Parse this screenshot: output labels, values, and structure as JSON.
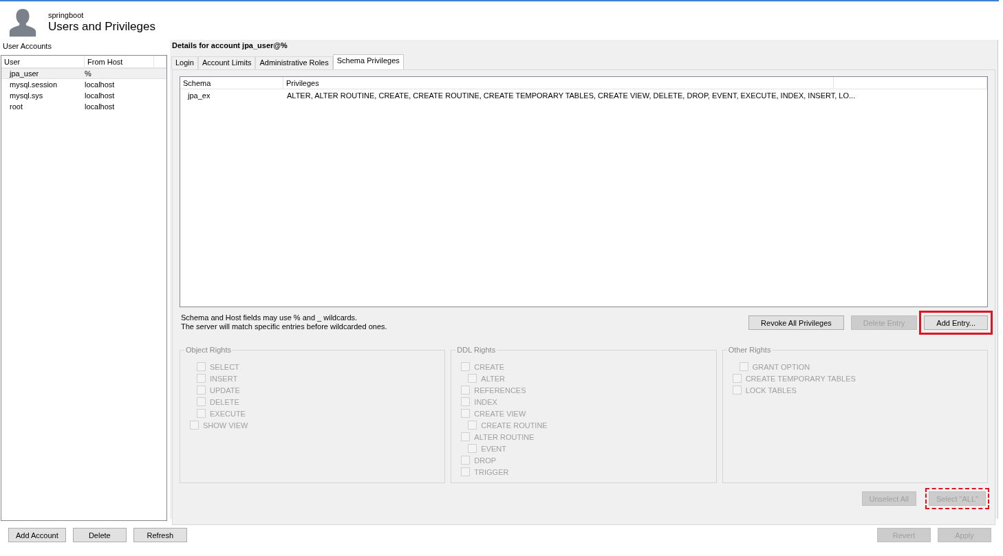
{
  "header": {
    "connection": "springboot",
    "title": "Users and Privileges"
  },
  "user_accounts": {
    "label": "User Accounts",
    "columns": [
      "User",
      "From Host"
    ],
    "rows": [
      {
        "user": "jpa_user",
        "host": "%",
        "selected": true
      },
      {
        "user": "mysql.session",
        "host": "localhost",
        "selected": false
      },
      {
        "user": "mysql.sys",
        "host": "localhost",
        "selected": false
      },
      {
        "user": "root",
        "host": "localhost",
        "selected": false
      }
    ],
    "buttons": [
      {
        "label": "Add Account",
        "disabled": false
      },
      {
        "label": "Delete",
        "disabled": false
      },
      {
        "label": "Refresh",
        "disabled": false
      }
    ]
  },
  "details": {
    "title": "Details for account jpa_user@%",
    "tabs": [
      {
        "label": "Login",
        "selected": false
      },
      {
        "label": "Account Limits",
        "selected": false
      },
      {
        "label": "Administrative Roles",
        "selected": false
      },
      {
        "label": "Schema Privileges",
        "selected": true
      }
    ],
    "privileges_table": {
      "columns": [
        "Schema",
        "Privileges"
      ],
      "rows": [
        {
          "schema": "jpa_ex",
          "privileges": "ALTER, ALTER ROUTINE, CREATE, CREATE ROUTINE, CREATE TEMPORARY TABLES, CREATE VIEW, DELETE, DROP, EVENT, EXECUTE, INDEX, INSERT, LO..."
        }
      ]
    },
    "hint_lines": [
      "Schema and Host fields may use % and _ wildcards.",
      "The server will match specific entries before wildcarded ones."
    ],
    "entry_buttons": [
      {
        "label": "Revoke All Privileges",
        "disabled": false,
        "kind": "plain"
      },
      {
        "label": "Delete Entry",
        "disabled": true,
        "kind": "plain"
      },
      {
        "label": "Add Entry...",
        "disabled": false,
        "kind": "boxed"
      }
    ],
    "rights_groups": [
      {
        "title": "Object Rights",
        "disabled": true,
        "items": [
          {
            "label": "SELECT",
            "kind": "sub",
            "checked": false
          },
          {
            "label": "INSERT",
            "kind": "sub",
            "checked": false
          },
          {
            "label": "UPDATE",
            "kind": "sub",
            "checked": false
          },
          {
            "label": "DELETE",
            "kind": "sub",
            "checked": false
          },
          {
            "label": "EXECUTE",
            "kind": "sub",
            "checked": false
          },
          {
            "label": "SHOW VIEW",
            "kind": "top",
            "checked": false
          }
        ]
      },
      {
        "title": "DDL Rights",
        "disabled": true,
        "items": [
          {
            "label": "CREATE",
            "kind": "top",
            "checked": false
          },
          {
            "label": "ALTER",
            "kind": "sub",
            "checked": false
          },
          {
            "label": "REFERENCES",
            "kind": "top",
            "checked": false
          },
          {
            "label": "INDEX",
            "kind": "top",
            "checked": false
          },
          {
            "label": "CREATE VIEW",
            "kind": "top",
            "checked": false
          },
          {
            "label": "CREATE ROUTINE",
            "kind": "sub",
            "checked": false
          },
          {
            "label": "ALTER ROUTINE",
            "kind": "top",
            "checked": false
          },
          {
            "label": "EVENT",
            "kind": "sub",
            "checked": false
          },
          {
            "label": "DROP",
            "kind": "top",
            "checked": false
          },
          {
            "label": "TRIGGER",
            "kind": "top",
            "checked": false
          }
        ]
      },
      {
        "title": "Other Rights",
        "disabled": true,
        "items": [
          {
            "label": "GRANT OPTION",
            "kind": "sub",
            "checked": false
          },
          {
            "label": "CREATE TEMPORARY TABLES",
            "kind": "top",
            "checked": false
          },
          {
            "label": "LOCK TABLES",
            "kind": "top",
            "checked": false
          }
        ]
      }
    ],
    "select_buttons": [
      {
        "label": "Unselect All",
        "disabled": true,
        "kind": "plain"
      },
      {
        "label": "Select \"ALL\"",
        "disabled": true,
        "kind": "dashed"
      }
    ],
    "footer_buttons": [
      {
        "label": "Revert",
        "disabled": true
      },
      {
        "label": "Apply",
        "disabled": true
      }
    ]
  }
}
